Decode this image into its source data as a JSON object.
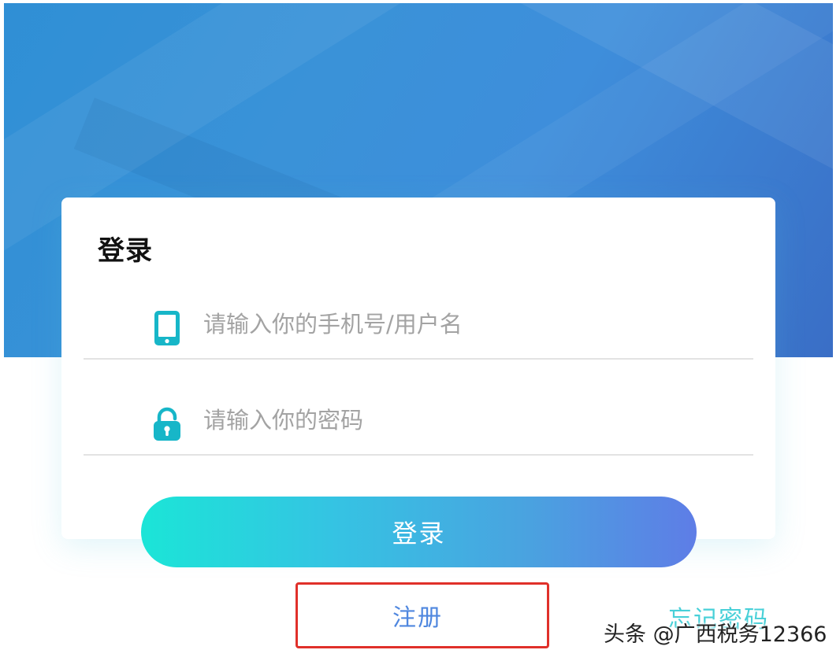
{
  "login_card": {
    "title": "登录",
    "username_placeholder": "请输入你的手机号/用户名",
    "password_placeholder": "请输入你的密码"
  },
  "actions": {
    "login_label": "登录",
    "register_label": "注册",
    "forgot_password_label": "忘记密码"
  },
  "watermark": "头条 @广西税务12366",
  "icons": {
    "username": "phone-icon",
    "password": "lock-icon"
  },
  "colors": {
    "icon_teal": "#17b6c8",
    "highlight_border": "#e0302a",
    "register_text": "#4f87df",
    "forgot_text": "#48d0d8"
  }
}
